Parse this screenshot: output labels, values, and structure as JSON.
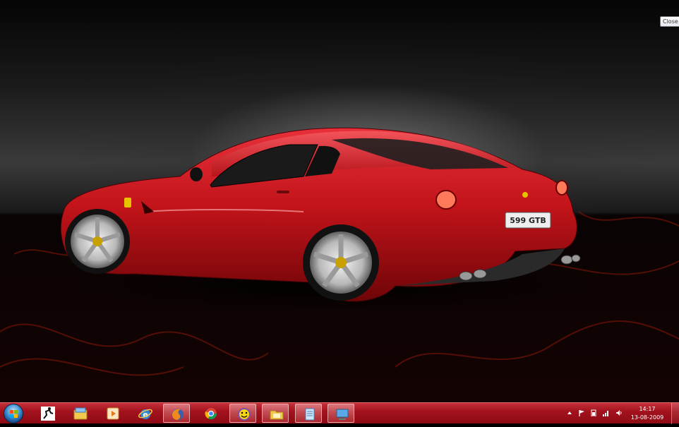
{
  "desktop": {
    "wallpaper": "red-ferrari-wallpaper",
    "car_plate_text": "599 GTB",
    "close_tooltip": "Close"
  },
  "taskbar": {
    "start_button": "windows-start-orb",
    "pinned": [
      {
        "name": "runner-app",
        "active": false
      },
      {
        "name": "windows-explorer",
        "active": false
      },
      {
        "name": "media-player",
        "active": false
      },
      {
        "name": "internet-explorer",
        "active": false
      },
      {
        "name": "firefox",
        "active": true
      },
      {
        "name": "chrome",
        "active": false
      },
      {
        "name": "yahoo-messenger",
        "active": true
      },
      {
        "name": "folder-app",
        "active": true
      },
      {
        "name": "notepad-app",
        "active": true
      },
      {
        "name": "remote-desktop",
        "active": true
      }
    ],
    "tray": {
      "icons": [
        "show-hidden-icons",
        "action-center-flag-icon",
        "power-icon",
        "network-signal-icon",
        "volume-icon"
      ],
      "time": "14:17",
      "date": "13-08-2009"
    }
  },
  "colors": {
    "taskbar_top": "#c5303a",
    "taskbar_bottom": "#8c0a14",
    "car_red": "#c2141a"
  }
}
